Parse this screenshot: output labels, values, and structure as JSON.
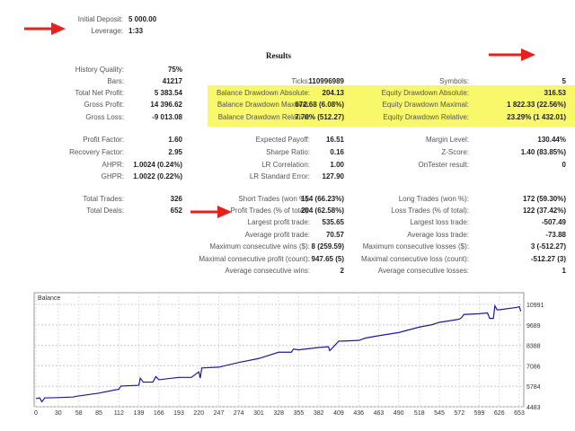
{
  "header": {
    "initial_deposit_label": "Initial Deposit:",
    "initial_deposit": "5 000.00",
    "leverage_label": "Leverage:",
    "leverage": "1:33"
  },
  "results_title": "Results",
  "col1": [
    {
      "label": "History Quality:",
      "value": "75%"
    },
    {
      "label": "Bars:",
      "value": "41217"
    },
    {
      "label": "Total Net Profit:",
      "value": "5 383.54"
    },
    {
      "label": "Gross Profit:",
      "value": "14 396.62"
    },
    {
      "label": "Gross Loss:",
      "value": "-9 013.08"
    },
    {
      "label": "Profit Factor:",
      "value": "1.60"
    },
    {
      "label": "Recovery Factor:",
      "value": "2.95"
    },
    {
      "label": "AHPR:",
      "value": "1.0024 (0.24%)"
    },
    {
      "label": "GHPR:",
      "value": "1.0022 (0.22%)"
    },
    {
      "label": "Total Trades:",
      "value": "326"
    },
    {
      "label": "Total Deals:",
      "value": "652"
    }
  ],
  "col2": [
    {
      "label": "Ticks:",
      "value": "110996989"
    },
    {
      "label": "Balance Drawdown Absolute:",
      "value": "204.13"
    },
    {
      "label": "Balance Drawdown Maximal:",
      "value": "672.68 (6.08%)"
    },
    {
      "label": "Balance Drawdown Relative:",
      "value": "7.70% (512.27)"
    },
    {
      "label": "Expected Payoff:",
      "value": "16.51"
    },
    {
      "label": "Sharpe Ratio:",
      "value": "0.16"
    },
    {
      "label": "LR Correlation:",
      "value": "1.00"
    },
    {
      "label": "LR Standard Error:",
      "value": "127.90"
    },
    {
      "label": "Short Trades (won %):",
      "value": "154 (66.23%)"
    },
    {
      "label": "Profit Trades (% of total):",
      "value": "204 (62.58%)"
    },
    {
      "label": "Largest profit trade:",
      "value": "535.65"
    },
    {
      "label": "Average profit trade:",
      "value": "70.57"
    },
    {
      "label": "Maximum consecutive wins ($):",
      "value": "8 (259.59)"
    },
    {
      "label": "Maximal consecutive profit (count):",
      "value": "947.65 (5)"
    },
    {
      "label": "Average consecutive wins:",
      "value": "2"
    }
  ],
  "col3": [
    {
      "label": "Symbols:",
      "value": "5"
    },
    {
      "label": "Equity Drawdown Absolute:",
      "value": "316.53"
    },
    {
      "label": "Equity Drawdown Maximal:",
      "value": "1 822.33 (22.56%)"
    },
    {
      "label": "Equity Drawdown Relative:",
      "value": "23.29% (1 432.01)"
    },
    {
      "label": "Margin Level:",
      "value": "130.44%"
    },
    {
      "label": "Z-Score:",
      "value": "1.40 (83.85%)"
    },
    {
      "label": "OnTester result:",
      "value": "0"
    },
    {
      "label": "Long Trades (won %):",
      "value": "172 (59.30%)"
    },
    {
      "label": "Loss Trades (% of total):",
      "value": "122 (37.42%)"
    },
    {
      "label": "Largest loss trade:",
      "value": "-507.49"
    },
    {
      "label": "Average loss trade:",
      "value": "-73.88"
    },
    {
      "label": "Maximum consecutive losses ($):",
      "value": "3 (-512.27)"
    },
    {
      "label": "Maximal consecutive loss (count):",
      "value": "-512.27 (3)"
    },
    {
      "label": "Average consecutive losses:",
      "value": "1"
    }
  ],
  "colors": {
    "highlight": "#f8f86a",
    "line": "#1a1aa0",
    "arrow": "#e8201c"
  },
  "chart_data": {
    "type": "line",
    "title": "Balance",
    "xlabel": "",
    "ylabel": "",
    "xlim": [
      0,
      660
    ],
    "ylim": [
      4483,
      11400
    ],
    "xticks": [
      0,
      30,
      58,
      85,
      112,
      139,
      166,
      193,
      220,
      247,
      274,
      301,
      328,
      355,
      382,
      409,
      436,
      463,
      490,
      518,
      545,
      572,
      599,
      626,
      653
    ],
    "yticks": [
      4483,
      5784,
      7086,
      8388,
      9689,
      10991
    ],
    "series": [
      {
        "name": "Balance",
        "x": [
          0,
          5,
          8,
          12,
          20,
          50,
          55,
          85,
          112,
          115,
          139,
          141,
          145,
          158,
          162,
          166,
          193,
          210,
          220,
          222,
          224,
          247,
          274,
          301,
          328,
          345,
          348,
          355,
          382,
          395,
          397,
          409,
          436,
          445,
          463,
          490,
          518,
          535,
          545,
          572,
          575,
          578,
          599,
          610,
          613,
          618,
          620,
          623,
          626,
          650,
          653,
          655
        ],
        "y": [
          5000,
          5050,
          4800,
          5050,
          5050,
          5100,
          5150,
          5350,
          5600,
          5800,
          5850,
          6300,
          6050,
          6050,
          6400,
          6200,
          6350,
          6350,
          6700,
          6300,
          6950,
          7000,
          7300,
          7550,
          7950,
          7950,
          8150,
          8100,
          8250,
          8300,
          8050,
          8650,
          8700,
          8850,
          9000,
          9200,
          9550,
          9700,
          9850,
          10050,
          10150,
          10350,
          10400,
          10450,
          10100,
          10100,
          10900,
          10650,
          10650,
          10800,
          10850,
          10550
        ]
      }
    ],
    "grid": true
  }
}
